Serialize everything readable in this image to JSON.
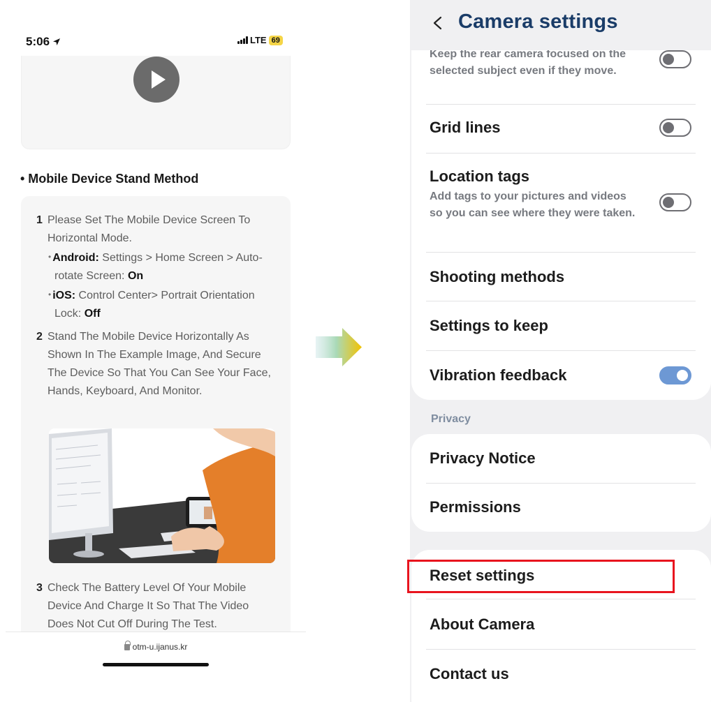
{
  "left": {
    "status": {
      "time": "5:06",
      "network": "LTE",
      "battery": "69"
    },
    "section_title": "• Mobile Device Stand Method",
    "steps": [
      {
        "num": "1",
        "text": "Please Set The Mobile Device Screen To Horizontal Mode.",
        "subs": [
          {
            "label": "Android:",
            "text": " Settings > Home Screen > Auto-rotate Screen: ",
            "value": "On"
          },
          {
            "label": "iOS:",
            "text": " Control Center> Portrait Orientation Lock: ",
            "value": "Off"
          }
        ]
      },
      {
        "num": "2",
        "text": "Stand The Mobile Device Horizontally As Shown In The Example Image, And Secure The Device So That You Can See Your Face, Hands, Keyboard, And Monitor."
      },
      {
        "num": "3",
        "text": "Check The Battery Level Of Your Mobile Device And Charge It So That The Video Does Not Cut Off During The Test."
      }
    ],
    "url": "otm-u.ijanus.kr"
  },
  "right": {
    "title": "Camera settings",
    "tracking_desc_partial": "Keep the rear camera focused on the selected subject even if they move.",
    "items": {
      "grid_lines": "Grid lines",
      "location_tags": "Location tags",
      "location_tags_desc": "Add tags to your pictures and videos so you can see where they were taken.",
      "shooting_methods": "Shooting methods",
      "settings_to_keep": "Settings to keep",
      "vibration_feedback": "Vibration feedback",
      "privacy_label": "Privacy",
      "privacy_notice": "Privacy Notice",
      "permissions": "Permissions",
      "reset_settings": "Reset settings",
      "about_camera": "About Camera",
      "contact_us": "Contact us"
    },
    "toggles": {
      "tracking": false,
      "grid_lines": false,
      "location_tags": false,
      "vibration_feedback": true
    },
    "colors": {
      "title": "#1a3c68",
      "toggle_on": "#6d98d4",
      "highlight": "#e8141e",
      "arrow_start": "#8fd3c7",
      "arrow_end": "#f2c200"
    }
  }
}
